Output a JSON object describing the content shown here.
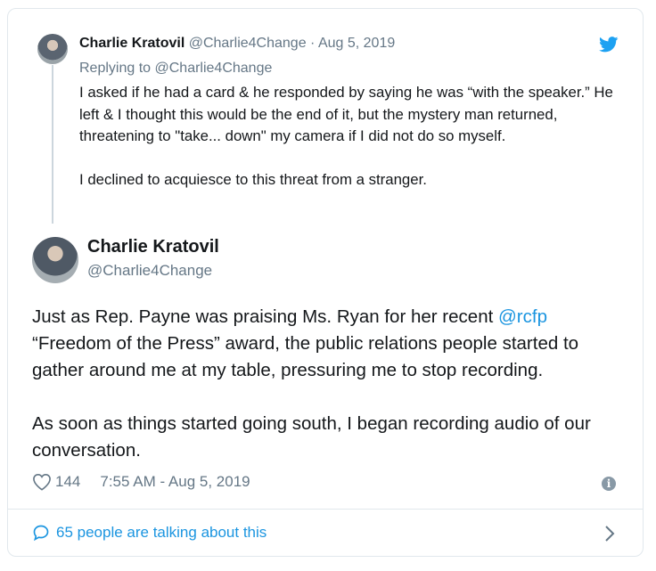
{
  "parent_tweet": {
    "author_name": "Charlie Kratovil",
    "author_handle": "@Charlie4Change",
    "separator": "·",
    "date": "Aug 5, 2019",
    "replying_label": "Replying to",
    "replying_handle": "@Charlie4Change",
    "paragraphs": [
      "I asked if he had a card & he responded by saying he was “with the speaker.” He left & I thought this would be the end of it, but the mystery man returned, threatening to \"take... down\" my camera if I did not do so myself.",
      "I declined to acquiesce to this threat from a stranger."
    ]
  },
  "main_tweet": {
    "author_name": "Charlie Kratovil",
    "author_handle": "@Charlie4Change",
    "text_part1": "Just as Rep. Payne was praising Ms. Ryan for her recent ",
    "mention": "@rcfp",
    "text_part2": " “Freedom of the Press” award, the public relations people started to gather around me at my table, pressuring me to stop recording.",
    "paragraph2": "As soon as things started going south, I began recording audio of our conversation.",
    "likes": "144",
    "timestamp": "7:55 AM - Aug 5, 2019"
  },
  "footer": {
    "talking": "65 people are talking about this"
  },
  "icons": {
    "brand": "twitter-bird-icon",
    "like": "heart-icon",
    "info": "info-icon",
    "conversation": "speech-bubble-icon",
    "expand": "chevron-right-icon"
  },
  "colors": {
    "link": "#1b95e0",
    "muted": "#657786",
    "text": "#14171a",
    "border": "#e1e8ed"
  }
}
